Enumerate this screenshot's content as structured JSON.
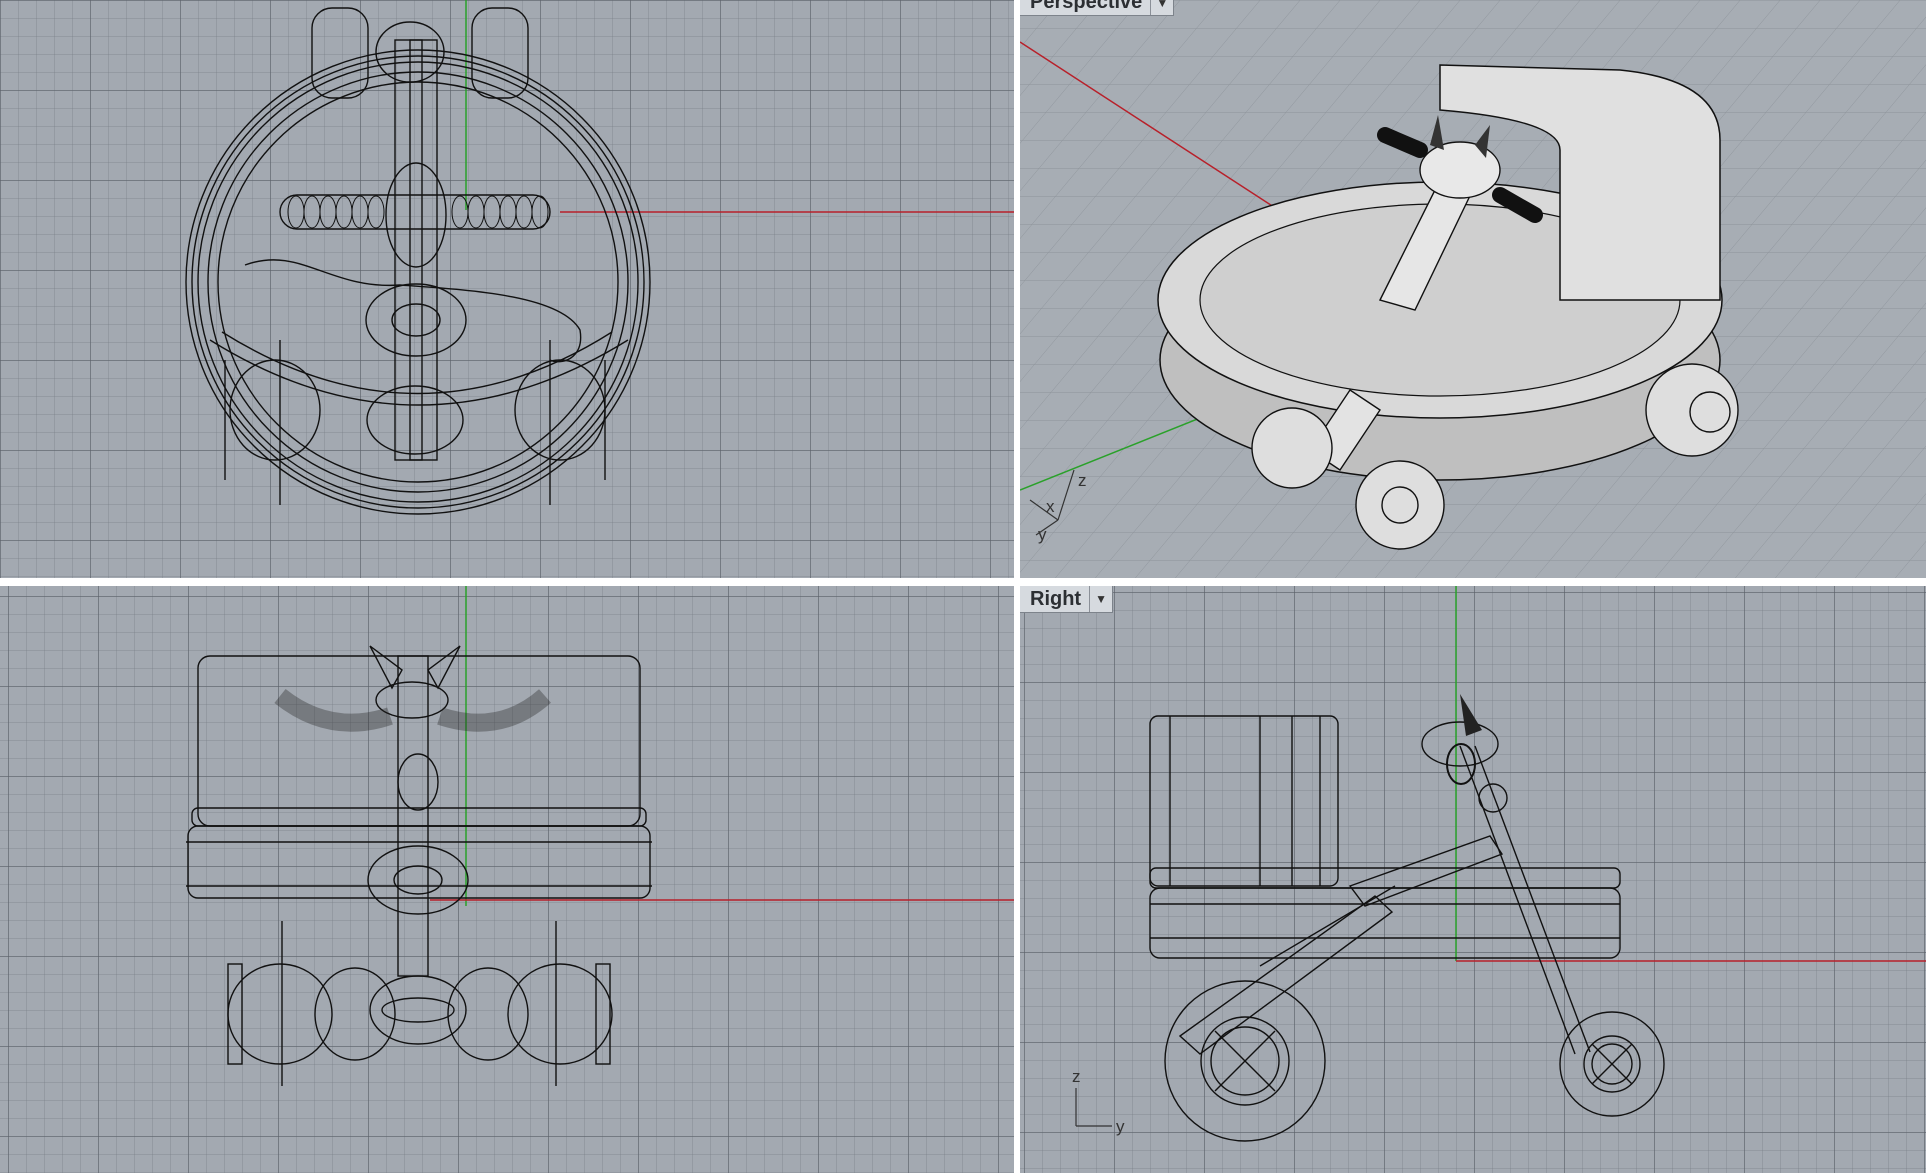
{
  "viewports": {
    "top": {
      "label": ""
    },
    "perspective": {
      "label": "Perspective"
    },
    "front": {
      "label": ""
    },
    "right": {
      "label": "Right"
    }
  },
  "axis_labels": {
    "perspective": {
      "x": "x",
      "y": "y",
      "z": "z"
    },
    "right": {
      "y": "y",
      "z": "z"
    }
  },
  "colors": {
    "viewport_bg": "#a3a9b1",
    "x_axis": "#b8202a",
    "y_axis": "#2aa12a",
    "wire": "#111111",
    "shaded": "#d8d8d8"
  },
  "icons": {
    "dropdown": "chevron-down-icon"
  }
}
